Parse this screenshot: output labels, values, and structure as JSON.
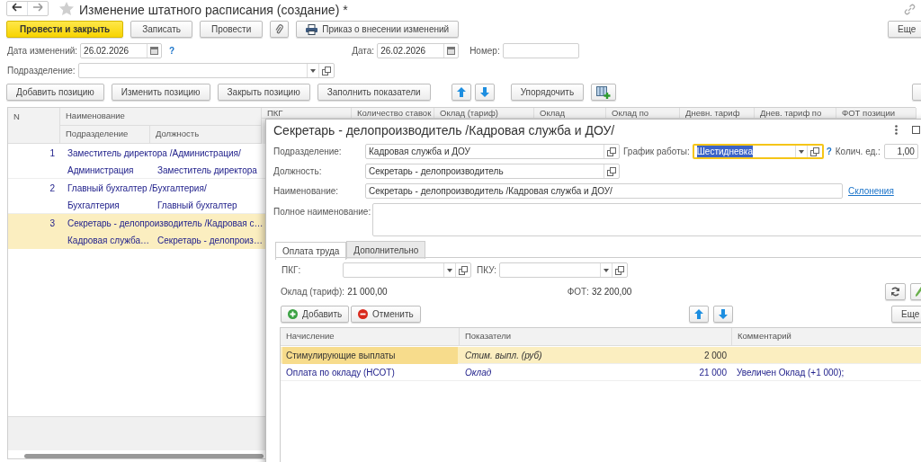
{
  "window": {
    "title": "Изменение штатного расписания (создание) *"
  },
  "toolbar": {
    "buttons": [
      {
        "kind": "primary",
        "label": "Провести и закрыть"
      },
      {
        "kind": "plain",
        "label": "Записать"
      },
      {
        "kind": "plain",
        "label": "Провести"
      },
      {
        "kind": "attach"
      },
      {
        "kind": "print",
        "label": "Приказ о внесении изменений"
      }
    ],
    "more": "Еще"
  },
  "header": {
    "change_date": {
      "label": "Дата изменений:",
      "value": "26.02.2026"
    },
    "help": "?",
    "date": {
      "label": "Дата:",
      "value": "26.02.2026"
    },
    "number": {
      "label": "Номер:"
    },
    "department": {
      "label": "Подразделение:"
    }
  },
  "positions_toolbar": {
    "buttons": [
      "Добавить позицию",
      "Изменить позицию",
      "Закрыть позицию",
      "Заполнить показатели"
    ],
    "sort": "Упорядочить"
  },
  "positions_table": {
    "columns": {
      "n": "N",
      "name": "Наименование",
      "department": "Подразделение",
      "position": "Должность"
    },
    "columns_behind": [
      "ПКГ",
      "Количество ставок",
      "Оклад (тариф)",
      "Оклад",
      "Оклад по",
      "Дневн. тариф",
      "Днев. тариф по",
      "ФОТ позиции"
    ],
    "rows": [
      {
        "n": "1",
        "name": "Заместитель директора /Администрация/",
        "department": "Администрация",
        "position": "Заместитель директора",
        "selected": false
      },
      {
        "n": "2",
        "name": "Главный бухгалтер /Бухгалтерия/",
        "department": "Бухгалтерия",
        "position": "Главный бухгалтер",
        "selected": false
      },
      {
        "n": "3",
        "name": "Секретарь - делопроизводитель /Кадровая с…",
        "department": "Кадровая служба…",
        "position": "Секретарь - делопроиз…",
        "selected": true
      }
    ]
  },
  "dialog": {
    "title": "Секретарь - делопроизводитель /Кадровая служба и ДОУ/",
    "department": {
      "label": "Подразделение:",
      "value": "Кадровая служба и ДОУ"
    },
    "schedule": {
      "label": "График работы:",
      "value": "Шестидневка"
    },
    "help": "?",
    "units": {
      "label": "Колич. ед.:",
      "value": "1,00"
    },
    "position": {
      "label": "Должность:",
      "value": "Секретарь - делопроизводитель"
    },
    "name": {
      "label": "Наименование:",
      "value": "Секретарь - делопроизводитель /Кадровая служба и ДОУ/"
    },
    "declensions_link": "Склонения",
    "full_name": {
      "label": "Полное наименование:"
    },
    "tabs": [
      {
        "label": "Оплата труда",
        "selected": true
      },
      {
        "label": "Дополнительно",
        "selected": false
      }
    ],
    "pkg": {
      "label": "ПКГ:"
    },
    "pku": {
      "label": "ПКУ:"
    },
    "salary": {
      "label": "Оклад (тариф):",
      "value": "21 000,00"
    },
    "fot": {
      "label": "ФОТ:",
      "value": "32 200,00"
    },
    "buttons": {
      "add": "Добавить",
      "cancel": "Отменить",
      "more": "Еще"
    },
    "accruals": {
      "columns": [
        "Начисление",
        "Показатели",
        "Комментарий"
      ],
      "rows": [
        {
          "accrual": "Стимулирующие выплаты",
          "indicator": "Стим. выпл. (руб)",
          "amount": "2 000",
          "selected": true
        },
        {
          "accrual": "Оплата по окладу (НСОТ)",
          "indicator": "Оклад",
          "amount": "21 000",
          "comment": "Увеличен Оклад (+1 000);",
          "selected": false
        }
      ]
    }
  }
}
